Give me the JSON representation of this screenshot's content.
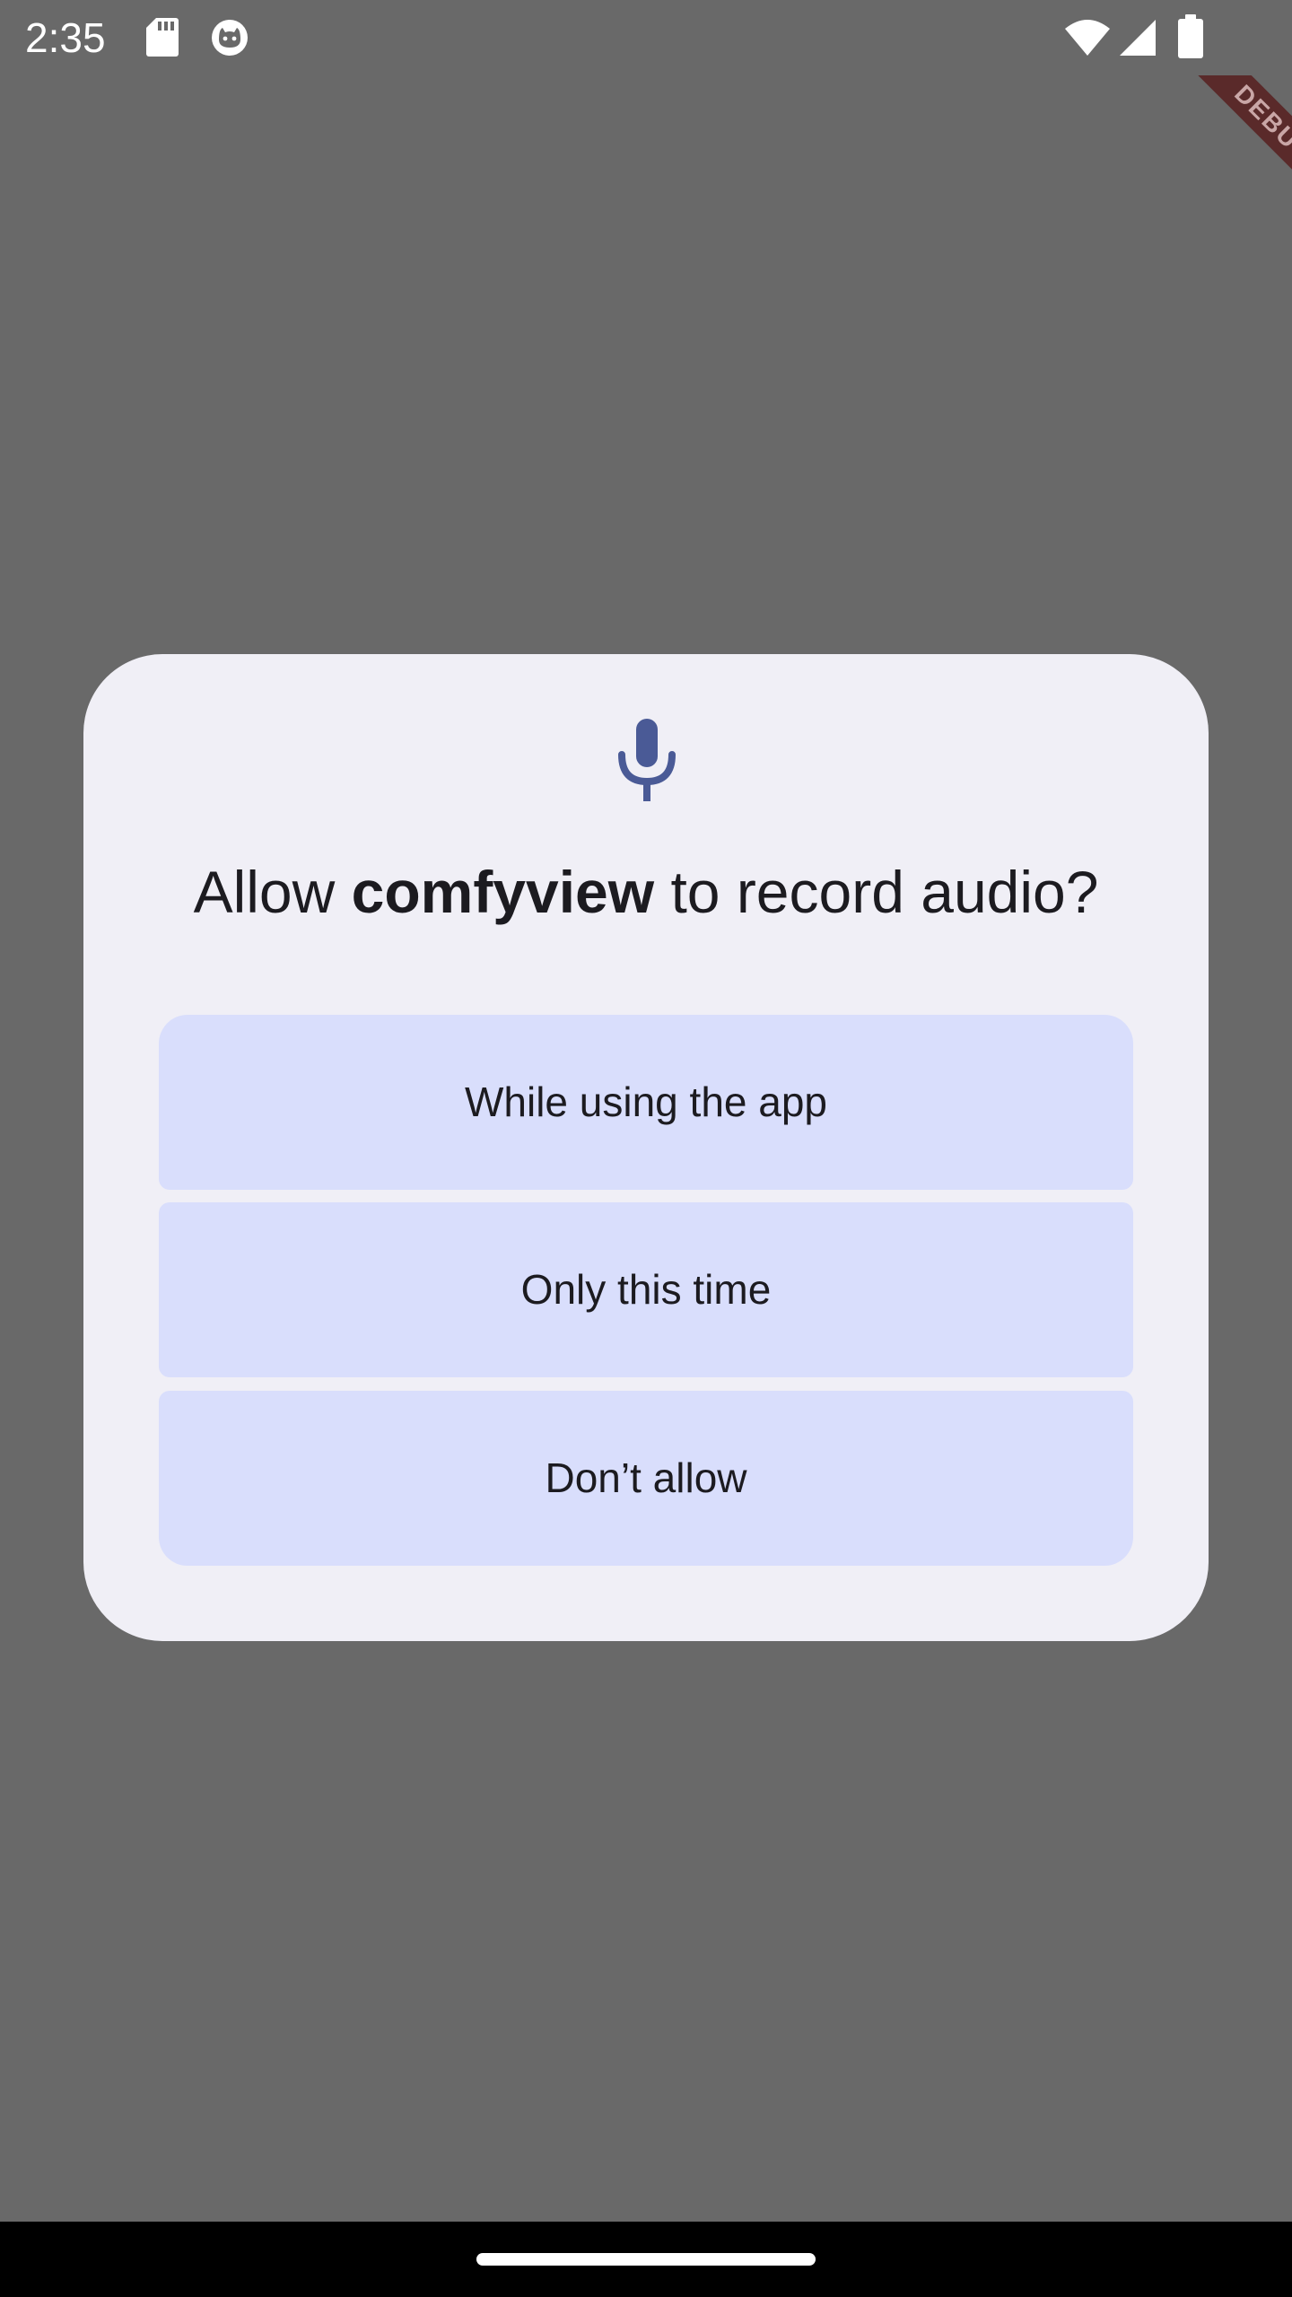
{
  "status_bar": {
    "time": "2:35",
    "icons": [
      "sd-card-icon",
      "cat-notification-icon",
      "wifi-icon",
      "cell-signal-icon",
      "battery-icon"
    ]
  },
  "debug_banner": {
    "label": "DEBUG"
  },
  "dialog": {
    "icon": "microphone-icon",
    "title_prefix": "Allow ",
    "app_name": "comfyview",
    "title_suffix": " to record audio?",
    "options": [
      {
        "label": "While using the app"
      },
      {
        "label": "Only this time"
      },
      {
        "label": "Don’t allow"
      }
    ]
  },
  "colors": {
    "scrim": "#696969",
    "dialog_bg": "#f0eff6",
    "button_bg": "#d9defc",
    "accent": "#4a5a96",
    "text": "#1c1b20"
  }
}
